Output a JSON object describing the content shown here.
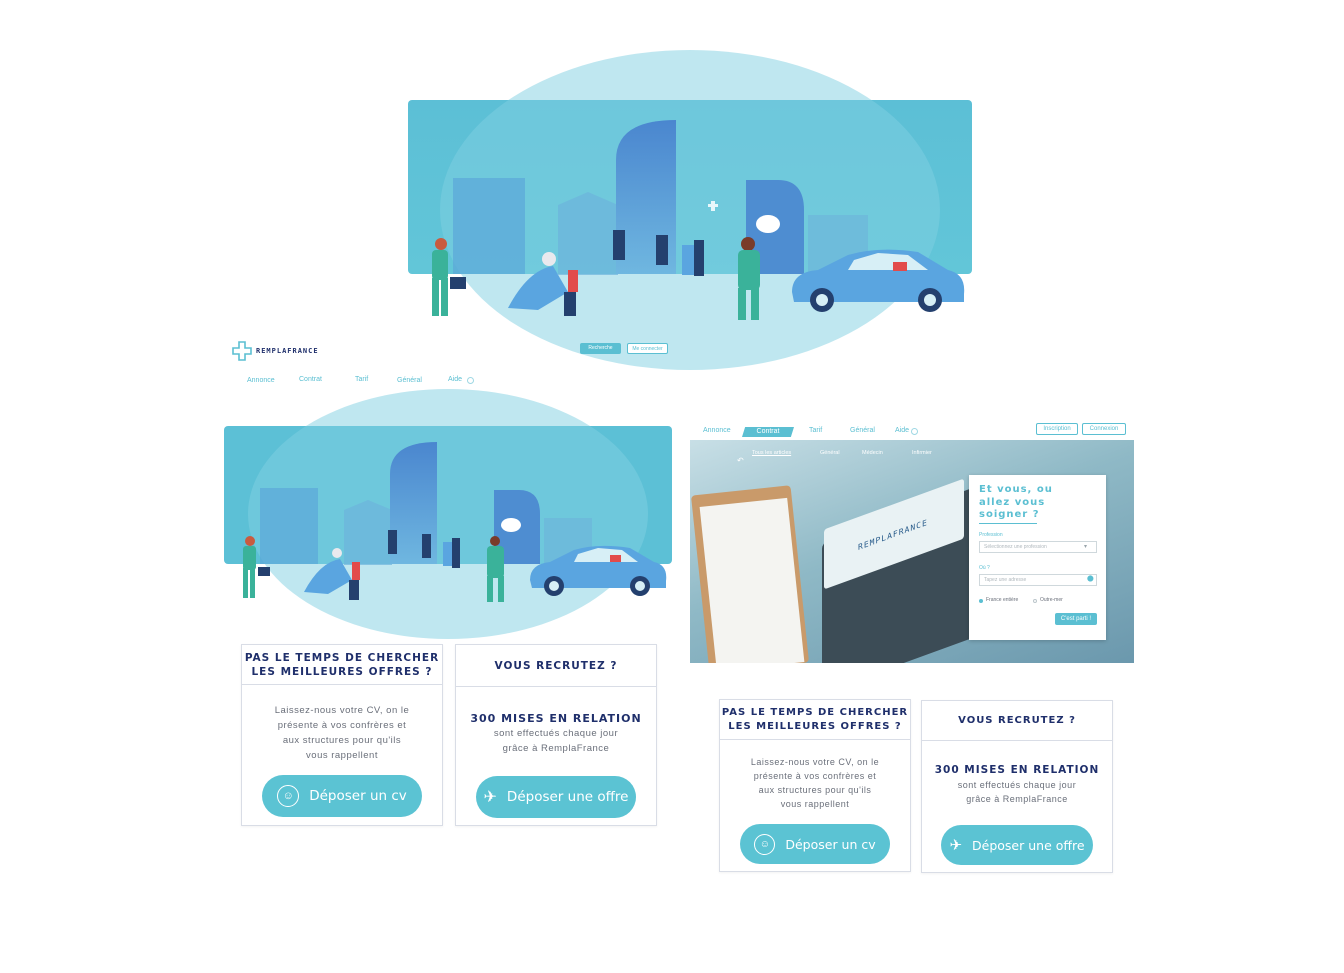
{
  "brand": {
    "name": "REMPLAFRANCE"
  },
  "colors": {
    "accent": "#5bbfd2",
    "navy": "#1f2f6b",
    "sky": "#5cc3d6"
  },
  "mid": {
    "buttons": {
      "primary": "Recherche",
      "secondary": "Me connecter"
    },
    "nav": [
      "Annonce",
      "Contrat",
      "Tarif",
      "Général",
      "Aide"
    ]
  },
  "mockup": {
    "tabs": [
      "Annonce",
      "Contrat",
      "Tarif",
      "Général",
      "Aide"
    ],
    "active_tab": "Contrat",
    "auth": {
      "signup": "Inscription",
      "login": "Connexion"
    },
    "subnav": [
      "Tous les articles",
      "Général",
      "Médecin",
      "Infirmier"
    ],
    "laptop_brand": "REMPLAFRANCE",
    "search": {
      "title_lines": [
        "Et vous, ou",
        "allez vous",
        "soigner ?"
      ],
      "profession_label": "Profession",
      "profession_placeholder": "Sélectionnez une profession",
      "where_label": "Où ?",
      "where_placeholder": "Tapez une adresse",
      "options": [
        "France entière",
        "Outre-mer"
      ],
      "submit": "C'est parti !"
    }
  },
  "cards_left": [
    {
      "title": [
        "PAS LE TEMPS DE CHERCHER",
        "LES MEILLEURES OFFRES ?"
      ],
      "text": [
        "Laissez-nous votre CV, on le",
        "présente à vos confrères et",
        "aux structures pour qu'ils",
        "vous rappellent"
      ],
      "button": "Déposer un cv",
      "icon": "user-icon"
    },
    {
      "title": [
        "VOUS RECRUTEZ ?"
      ],
      "strong": "300 MISES EN RELATION",
      "text": [
        "sont effectués chaque jour",
        "grâce à RemplaFrance"
      ],
      "button": "Déposer une offre",
      "icon": "paper-plane-icon"
    }
  ],
  "cards_right": [
    {
      "title": [
        "PAS LE TEMPS DE CHERCHER",
        "LES MEILLEURES OFFRES ?"
      ],
      "text": [
        "Laissez-nous votre CV, on le",
        "présente à vos confrères et",
        "aux structures pour qu'ils",
        "vous rappellent"
      ],
      "button": "Déposer un cv",
      "icon": "user-icon"
    },
    {
      "title": [
        "VOUS RECRUTEZ ?"
      ],
      "strong": "300 MISES EN RELATION",
      "text": [
        "sont effectués chaque jour",
        "grâce à RemplaFrance"
      ],
      "button": "Déposer une offre",
      "icon": "paper-plane-icon"
    }
  ]
}
